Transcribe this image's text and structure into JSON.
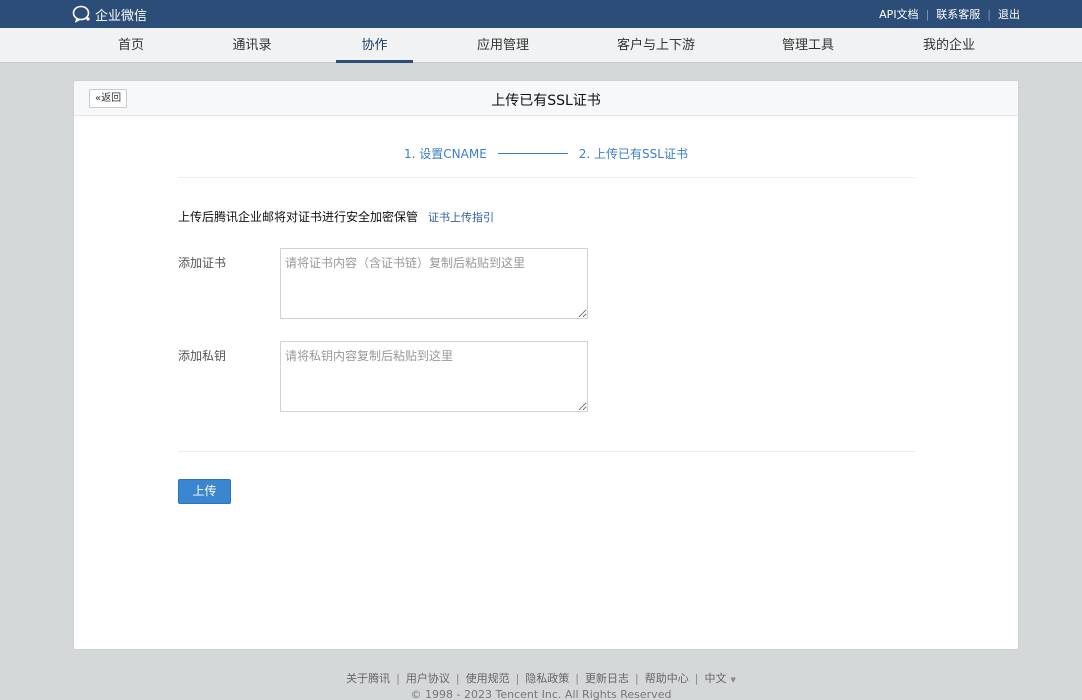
{
  "topbar": {
    "logo_text": "企业微信",
    "links": [
      "API文档",
      "联系客服",
      "退出"
    ]
  },
  "nav": {
    "items": [
      "首页",
      "通讯录",
      "协作",
      "应用管理",
      "客户与上下游",
      "管理工具",
      "我的企业"
    ],
    "active": "协作"
  },
  "card": {
    "back_label": "返回",
    "title": "上传已有SSL证书",
    "steps": [
      "1. 设置CNAME",
      "2. 上传已有SSL证书"
    ],
    "intro_text": "上传后腾讯企业邮将对证书进行安全加密保管",
    "guide_link": "证书上传指引",
    "cert_label": "添加证书",
    "cert_placeholder": "请将证书内容（含证书链）复制后粘贴到这里",
    "key_label": "添加私钥",
    "key_placeholder": "请将私钥内容复制后粘贴到这里",
    "upload_label": "上传"
  },
  "footer": {
    "links": [
      "关于腾讯",
      "用户协议",
      "使用规范",
      "隐私政策",
      "更新日志",
      "帮助中心"
    ],
    "language": "中文",
    "copyright": "© 1998 - 2023 Tencent Inc. All Rights Reserved"
  },
  "colors": {
    "topbar": "#2c4d78",
    "accent": "#3a86d0",
    "link": "#2c5f9e"
  }
}
